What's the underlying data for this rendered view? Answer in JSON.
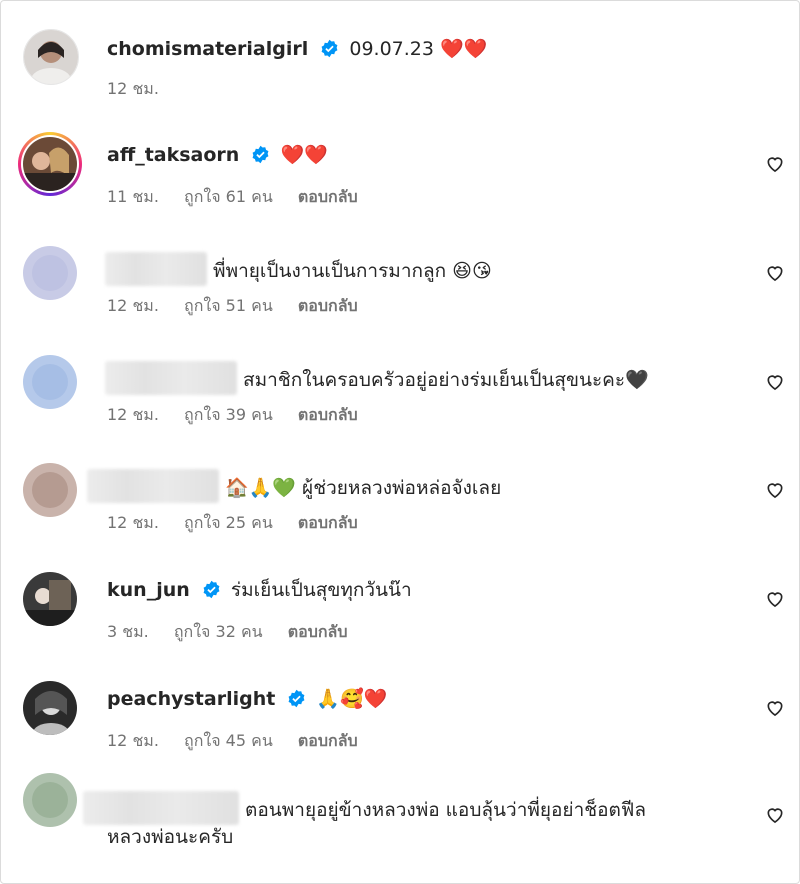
{
  "caption": {
    "username": "chomismaterialgirl",
    "date_text": "09.07.23 ❤️❤️",
    "time": "12 ชม."
  },
  "comments": [
    {
      "username": "aff_taksaorn",
      "verified": true,
      "text": "❤️❤️",
      "time": "11 ชม.",
      "likes": "ถูกใจ 61 คน",
      "reply": "ตอบกลับ"
    },
    {
      "username": "",
      "verified": false,
      "text": "พี่พายุเป็นงานเป็นการมากลูก 😆😘",
      "time": "12 ชม.",
      "likes": "ถูกใจ 51 คน",
      "reply": "ตอบกลับ"
    },
    {
      "username": "",
      "verified": false,
      "text": "สมาชิกในครอบครัวอยู่อย่างร่มเย็นเป็นสุขนะคะ🖤",
      "time": "12 ชม.",
      "likes": "ถูกใจ 39 คน",
      "reply": "ตอบกลับ"
    },
    {
      "username": "",
      "verified": false,
      "text": "🏠🙏💚 ผู้ช่วยหลวงพ่อหล่อจังเลย",
      "time": "12 ชม.",
      "likes": "ถูกใจ 25 คน",
      "reply": "ตอบกลับ"
    },
    {
      "username": "kun_jun",
      "verified": true,
      "text": "ร่มเย็นเป็นสุขทุกวันน๊า",
      "time": "3 ชม.",
      "likes": "ถูกใจ 32 คน",
      "reply": "ตอบกลับ"
    },
    {
      "username": "peachystarlight",
      "verified": true,
      "text": "🙏🥰❤️",
      "time": "12 ชม.",
      "likes": "ถูกใจ 45 คน",
      "reply": "ตอบกลับ"
    },
    {
      "username": "",
      "verified": false,
      "text": "ตอนพายุอยู่ข้างหลวงพ่อ แอบลุ้นว่าพี่ยุอย่าช็อตฟีล",
      "text2": "หลวงพ่อนะครับ"
    }
  ],
  "icons": {
    "verified": "verified-badge-icon",
    "like": "heart-outline-icon"
  },
  "colors": {
    "verified": "#0095f6",
    "meta": "#737373",
    "text": "#262626"
  }
}
